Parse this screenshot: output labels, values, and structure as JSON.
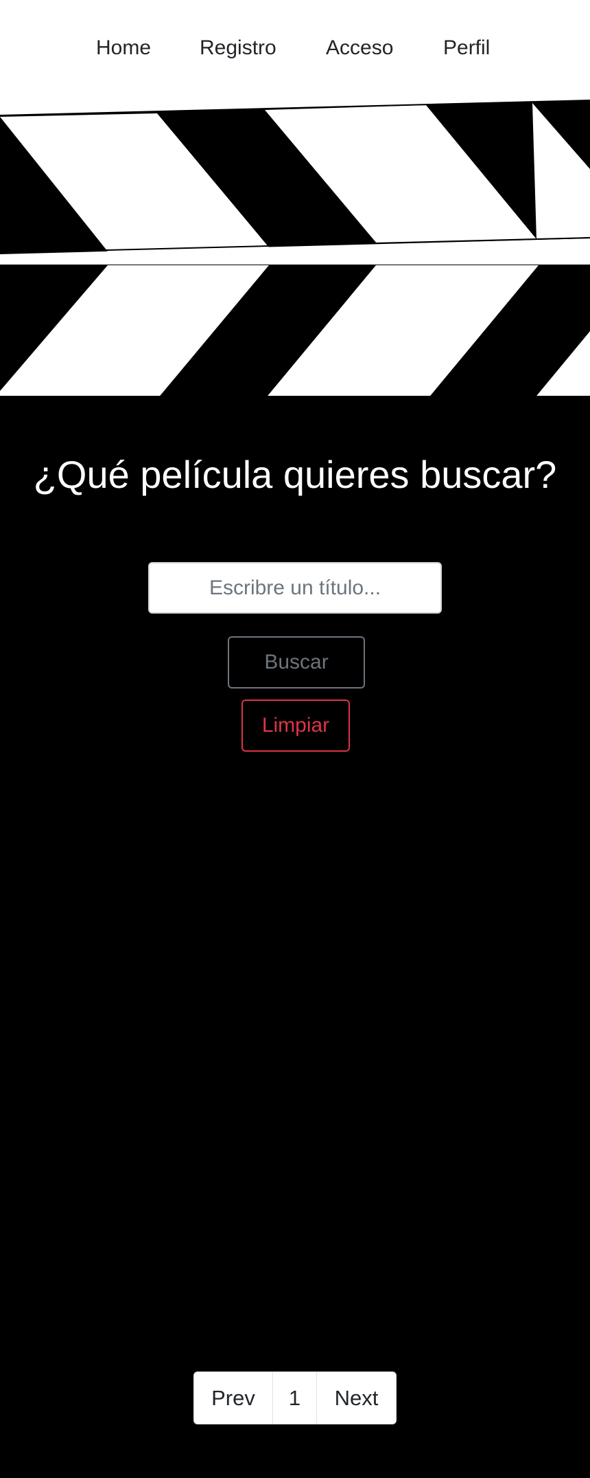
{
  "nav": {
    "items": [
      {
        "label": "Home"
      },
      {
        "label": "Registro"
      },
      {
        "label": "Acceso"
      },
      {
        "label": "Perfil"
      }
    ]
  },
  "hero": {
    "title": "¿Qué película quieres buscar?"
  },
  "search": {
    "placeholder": "Escribre un título...",
    "value": "",
    "search_label": "Buscar",
    "clear_label": "Limpiar"
  },
  "pagination": {
    "prev_label": "Prev",
    "current_page": "1",
    "next_label": "Next"
  },
  "colors": {
    "background": "#000000",
    "nav_background": "#ffffff",
    "search_button": "#6c757d",
    "clear_button": "#dc3545"
  },
  "icons": {
    "header_graphic": "clapperboard-icon"
  }
}
